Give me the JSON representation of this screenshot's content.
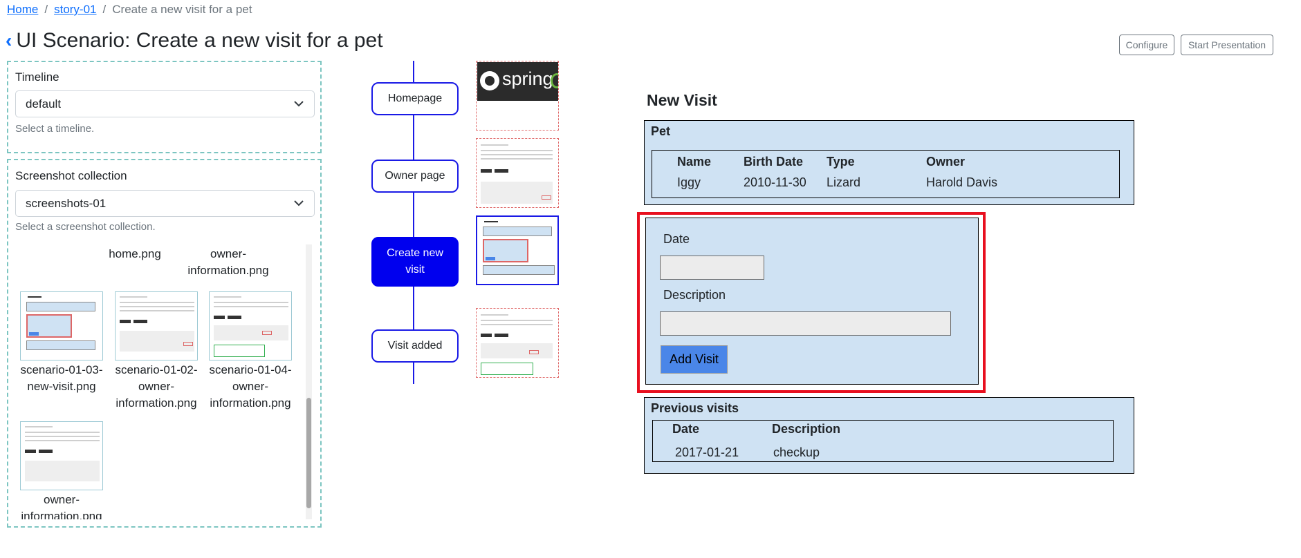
{
  "breadcrumb": {
    "home": "Home",
    "story": "story-01",
    "current": "Create a new visit for a pet"
  },
  "title": {
    "back": "‹",
    "text": "UI Scenario: Create a new visit for a pet"
  },
  "actions": {
    "configure": "Configure",
    "start": "Start Presentation"
  },
  "timeline_panel": {
    "label": "Timeline",
    "value": "default",
    "help": "Select a timeline."
  },
  "collection_panel": {
    "label": "Screenshot collection",
    "value": "screenshots-01",
    "help": "Select a screenshot collection."
  },
  "gallery": {
    "row1": [
      "home.png",
      "owner-\ninformation.png"
    ],
    "row2": [
      "scenario-01-03-\nnew-visit.png",
      "scenario-01-02-\nowner-\ninformation.png",
      "scenario-01-04-\nowner-\ninformation.png"
    ],
    "row3": [
      "owner-\ninformation.png"
    ]
  },
  "steps": [
    "Homepage",
    "Owner page",
    "Create new visit",
    "Visit added"
  ],
  "spring_word": "spring",
  "new_visit": {
    "title": "New Visit",
    "pet_label": "Pet",
    "pet_headers": [
      "Name",
      "Birth Date",
      "Type",
      "Owner"
    ],
    "pet_values": [
      "Iggy",
      "2010-11-30",
      "Lizard",
      "Harold Davis"
    ],
    "date_label": "Date",
    "description_label": "Description",
    "add_button": "Add Visit",
    "previous_label": "Previous visits",
    "prev_headers": [
      "Date",
      "Description"
    ],
    "prev_values": [
      "2017-01-21",
      "checkup"
    ]
  },
  "colors": {
    "accent": "#0d6efd",
    "timeline": "#1a1ae6",
    "active_step": "#0000ee",
    "highlight": "#e8101f",
    "preview_bg": "#cfe2f3"
  }
}
